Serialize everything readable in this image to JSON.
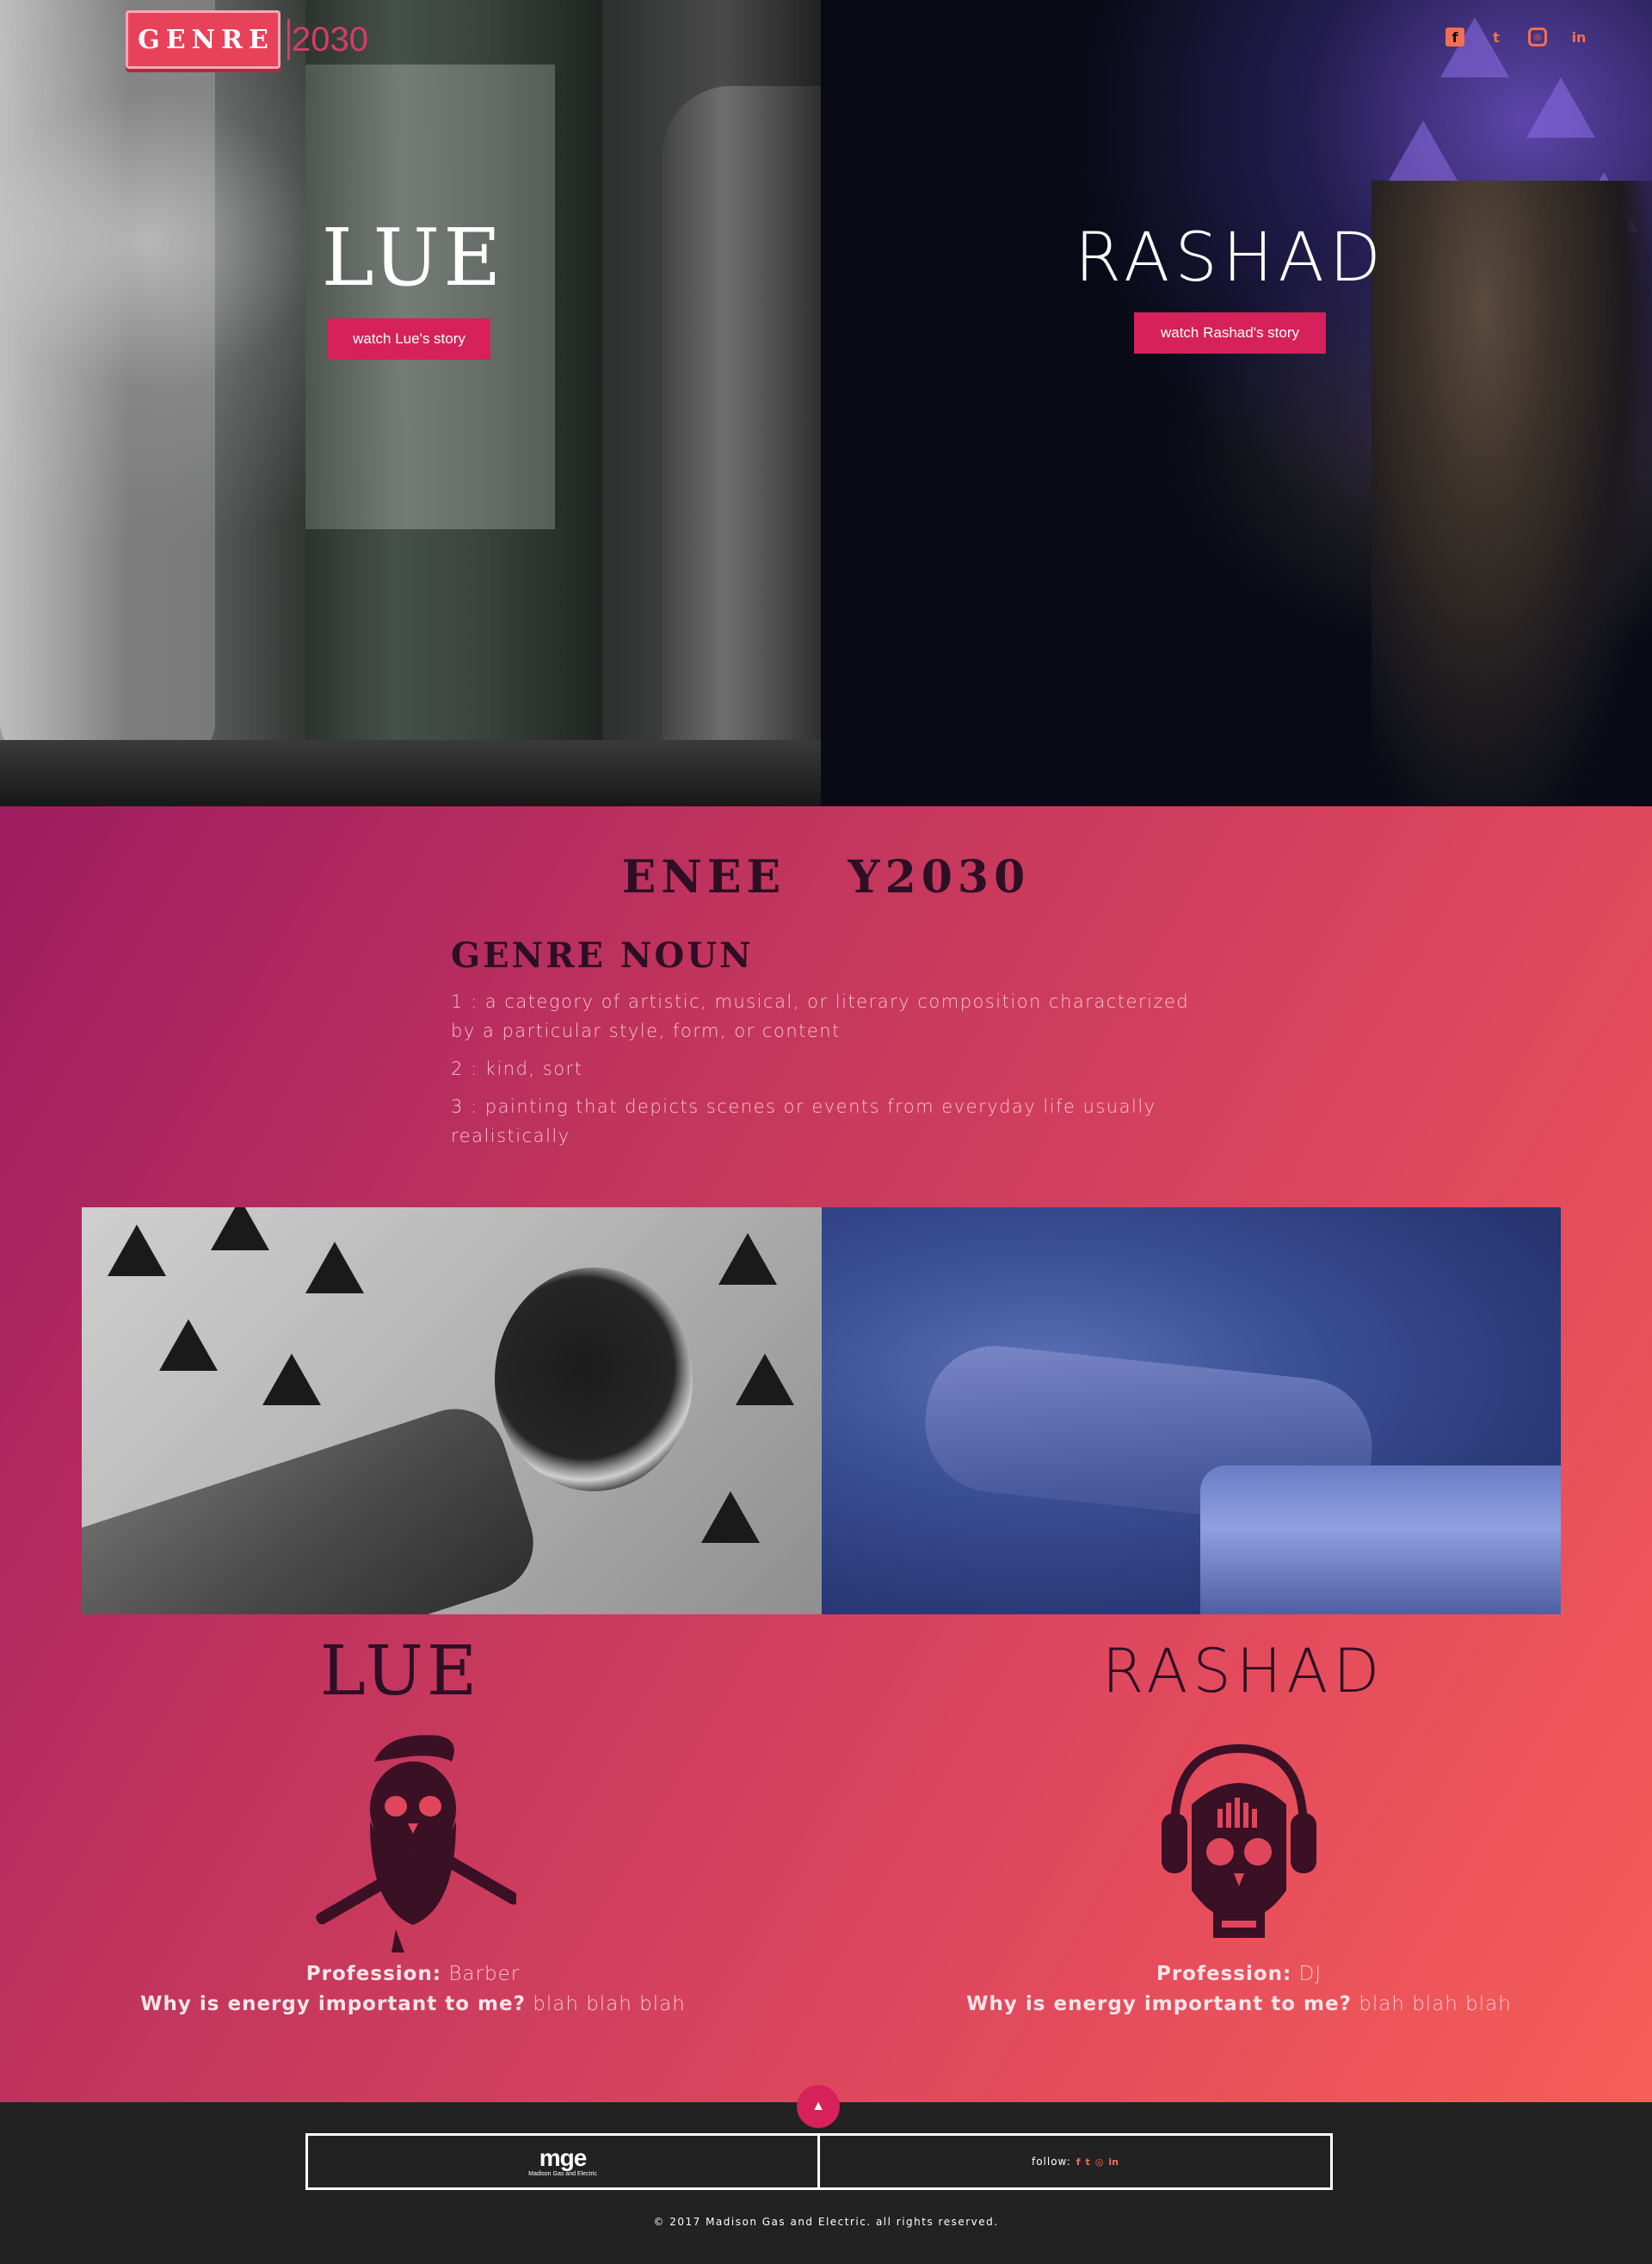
{
  "brand": {
    "logo_letters": [
      "G",
      "E",
      "N",
      "R",
      "E"
    ],
    "logo_number": "2030"
  },
  "socials": [
    {
      "icon": "facebook-icon",
      "glyph": "f"
    },
    {
      "icon": "twitter-icon",
      "glyph": "t"
    },
    {
      "icon": "instagram-icon",
      "glyph": "◎"
    },
    {
      "icon": "linkedin-icon",
      "glyph": "in"
    }
  ],
  "hero": {
    "left": {
      "name": "LUE",
      "button_label": "watch Lue's story"
    },
    "right": {
      "name": "RASHAD",
      "button_label": "watch Rashad's story"
    }
  },
  "definition": {
    "title": "ENEE   Y2030",
    "heading": "GENRE NOUN",
    "entries": [
      "1 : a category of artistic, musical, or literary composition characterized by a particular style, form, or content",
      "2 : kind, sort",
      "3 : painting that depicts scenes or events from everyday life usually realistically"
    ]
  },
  "people": [
    {
      "name": "LUE",
      "profession_label": "Profession:",
      "profession": "Barber",
      "question": "Why is energy important to me?",
      "answer": "blah blah blah",
      "avatar_icon": "bearded-skull-razor-icon"
    },
    {
      "name": "RASHAD",
      "profession_label": "Profession:",
      "profession": "DJ",
      "question": "Why is energy important to me?",
      "answer": "blah blah blah",
      "avatar_icon": "headphone-skull-icon"
    }
  ],
  "footer": {
    "logo_text": "mge",
    "logo_subtext": "Madison Gas and Electric",
    "follow_label": "follow:",
    "follow_icons": [
      "f",
      "t",
      "◎",
      "in"
    ],
    "copyright": "© 2017 Madison Gas and Electric. all rights reserved.",
    "top_icon": "chevron-up-icon"
  },
  "colors": {
    "accent": "#d6215a",
    "social": "#f36f52",
    "text_dark": "#2d0f25",
    "gradient_start": "#9e1c60",
    "gradient_end": "#f65e57",
    "footer_bg": "#222222"
  }
}
